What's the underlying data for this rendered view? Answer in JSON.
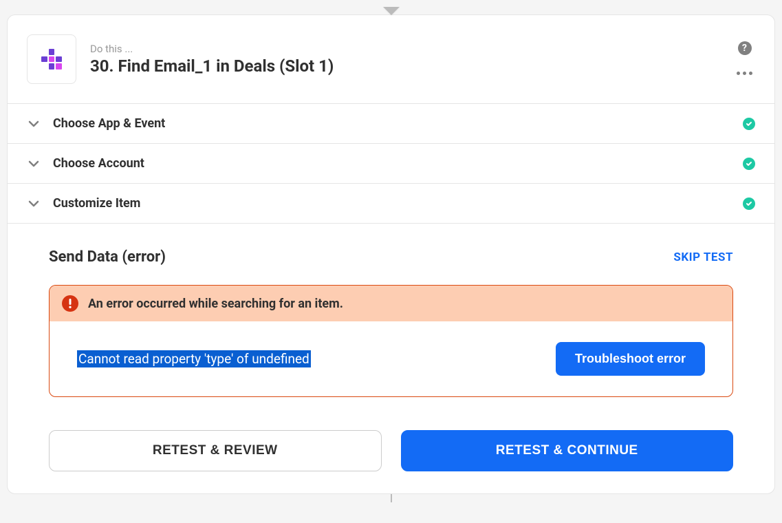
{
  "header": {
    "subtitle": "Do this ...",
    "title": "30. Find Email_1 in Deals (Slot 1)"
  },
  "sections": {
    "app_event": "Choose App & Event",
    "account": "Choose Account",
    "customize": "Customize Item"
  },
  "content": {
    "title": "Send Data (error)",
    "skip_test": "SKIP TEST"
  },
  "error": {
    "title": "An error occurred while searching for an item.",
    "message": "Cannot read property 'type' of undefined",
    "troubleshoot": "Troubleshoot error"
  },
  "buttons": {
    "retest_review": "RETEST & REVIEW",
    "retest_continue": "RETEST & CONTINUE"
  }
}
